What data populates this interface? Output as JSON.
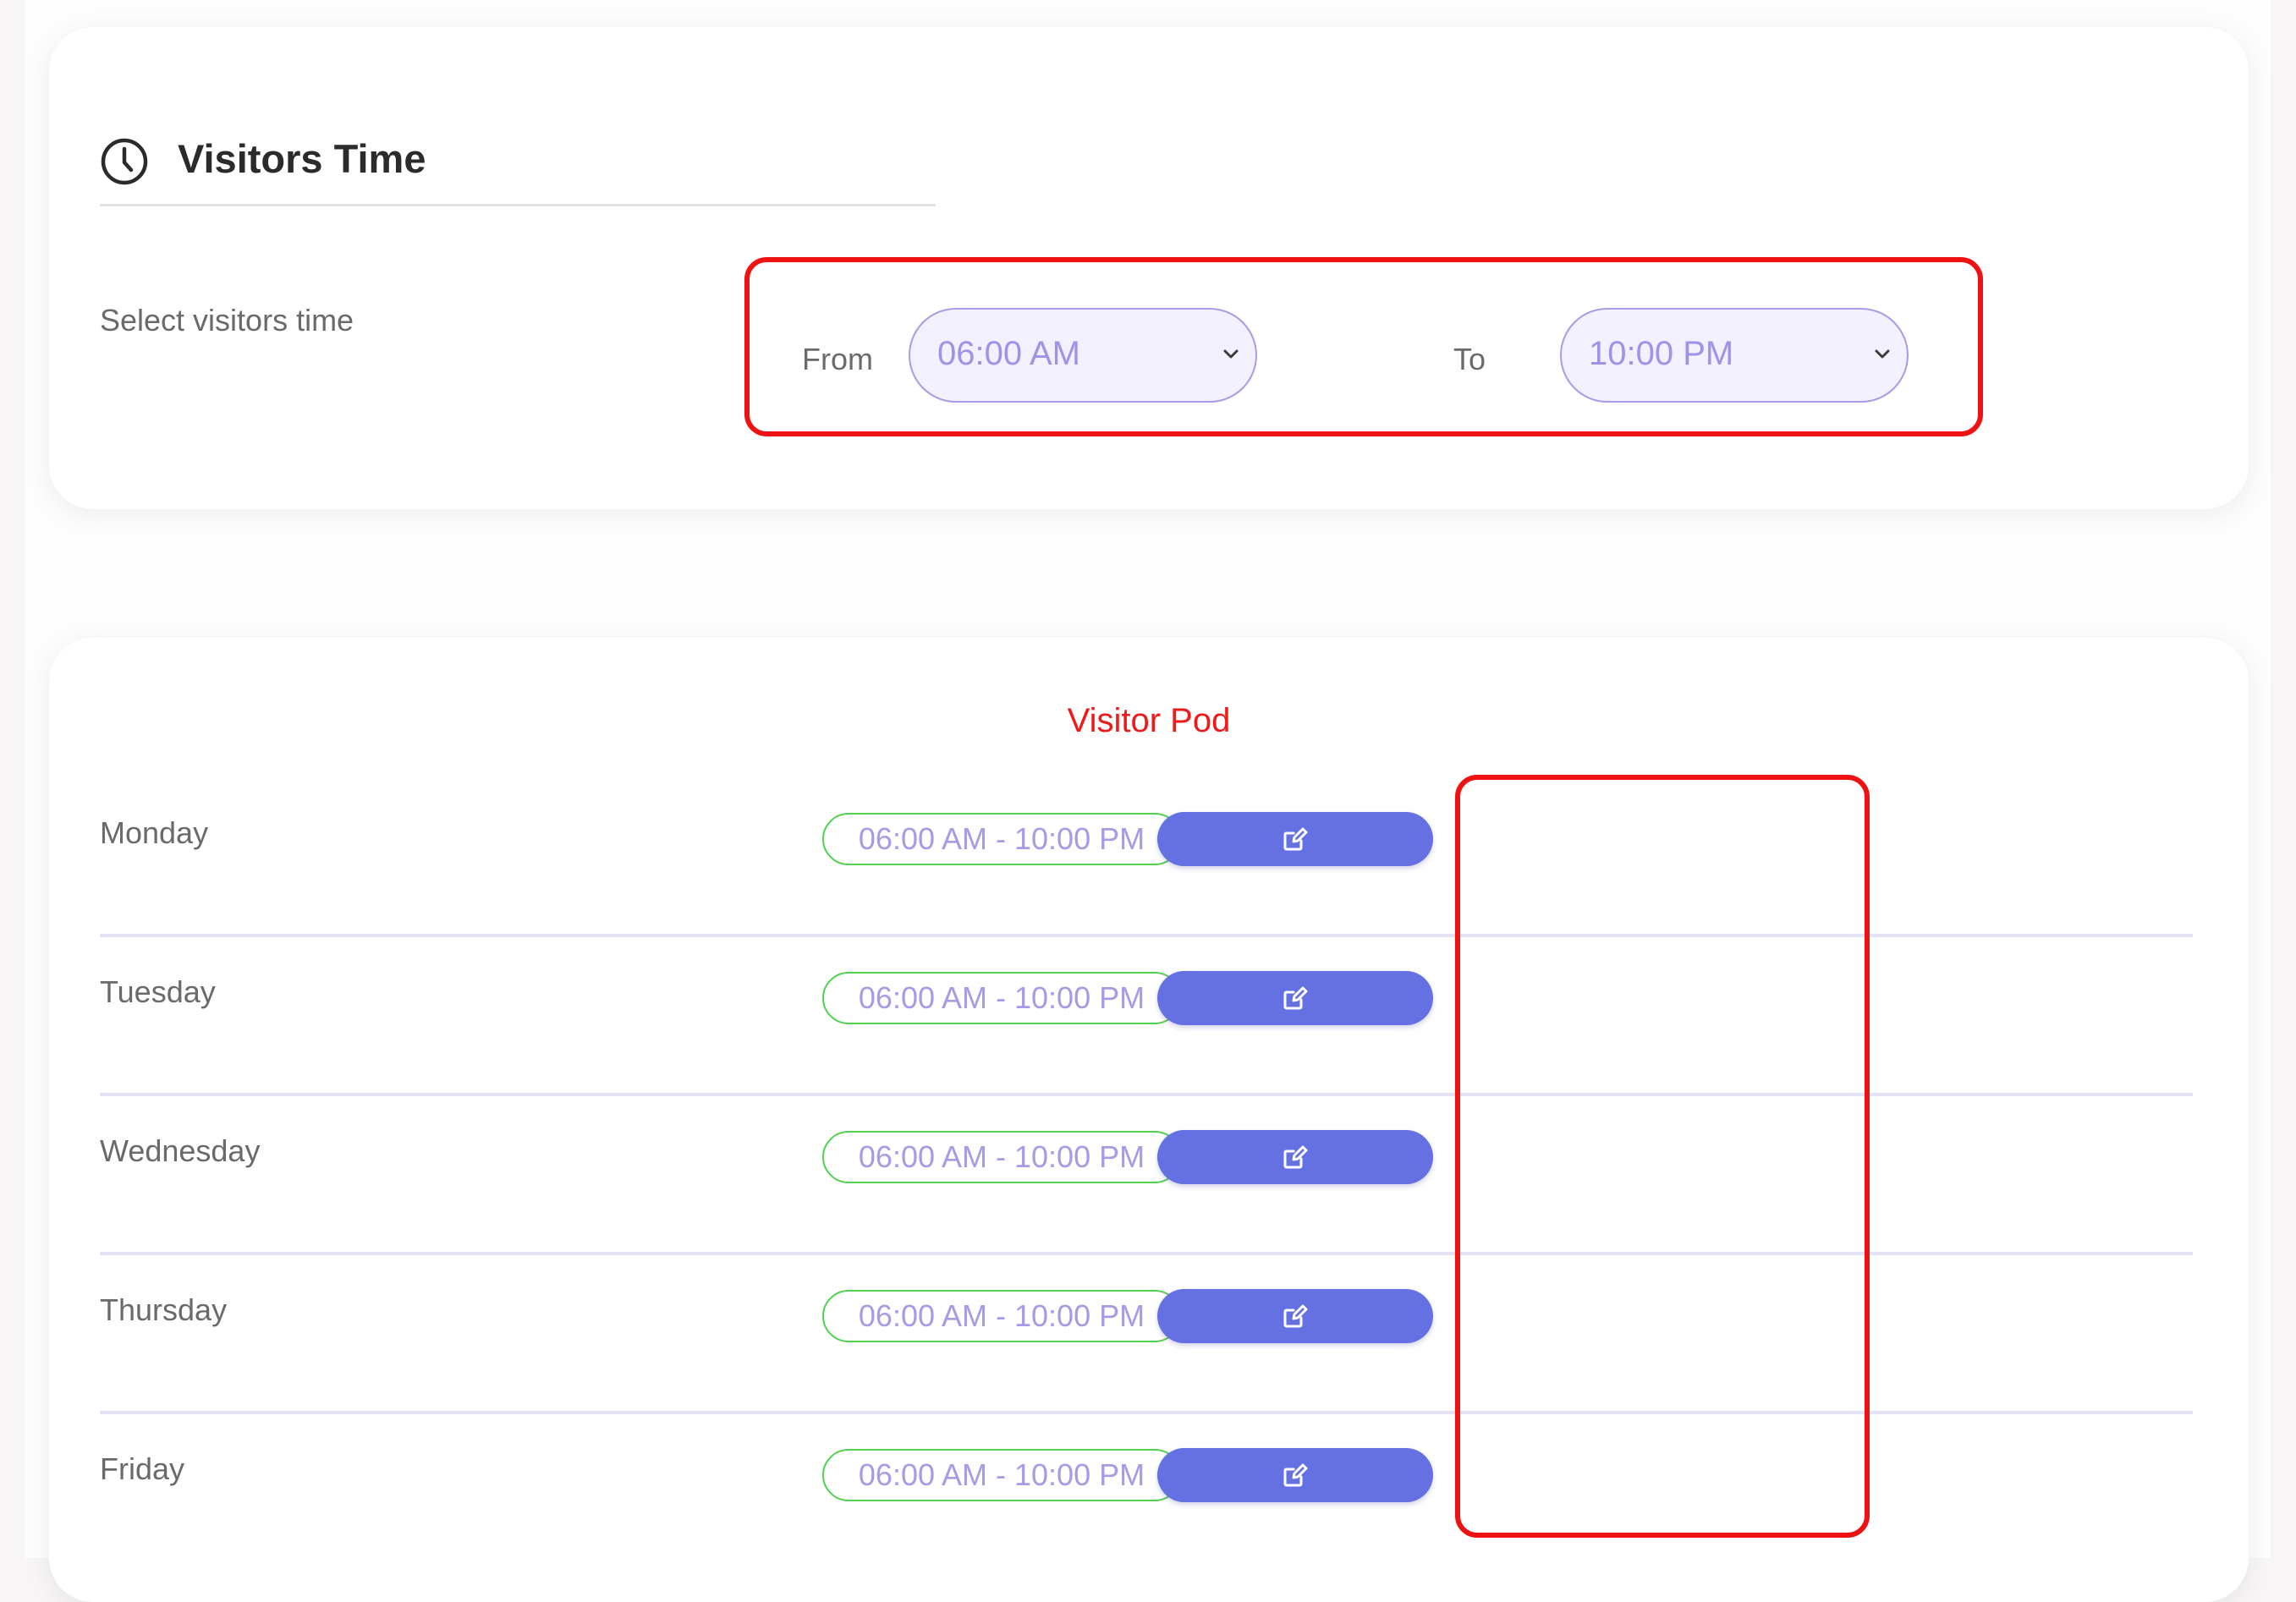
{
  "visitors_time": {
    "title": "Visitors Time",
    "icon": "clock-icon",
    "select_label": "Select visitors time",
    "from_label": "From",
    "from_value": "06:00 AM",
    "to_label": "To",
    "to_value": "10:00 PM"
  },
  "visitor_pod": {
    "title": "Visitor Pod",
    "days": [
      {
        "day": "Monday",
        "hours": "06:00 AM - 10:00 PM"
      },
      {
        "day": "Tuesday",
        "hours": "06:00 AM - 10:00 PM"
      },
      {
        "day": "Wednesday",
        "hours": "06:00 AM - 10:00 PM"
      },
      {
        "day": "Thursday",
        "hours": "06:00 AM - 10:00 PM"
      },
      {
        "day": "Friday",
        "hours": "06:00 AM - 10:00 PM"
      }
    ],
    "edit_icon": "edit-icon"
  },
  "colors": {
    "accent": "#6571e3",
    "highlight": "#ee1212",
    "pod_title": "#ee1a1a",
    "badge_border": "#52d052",
    "badge_text": "#a69be4"
  }
}
